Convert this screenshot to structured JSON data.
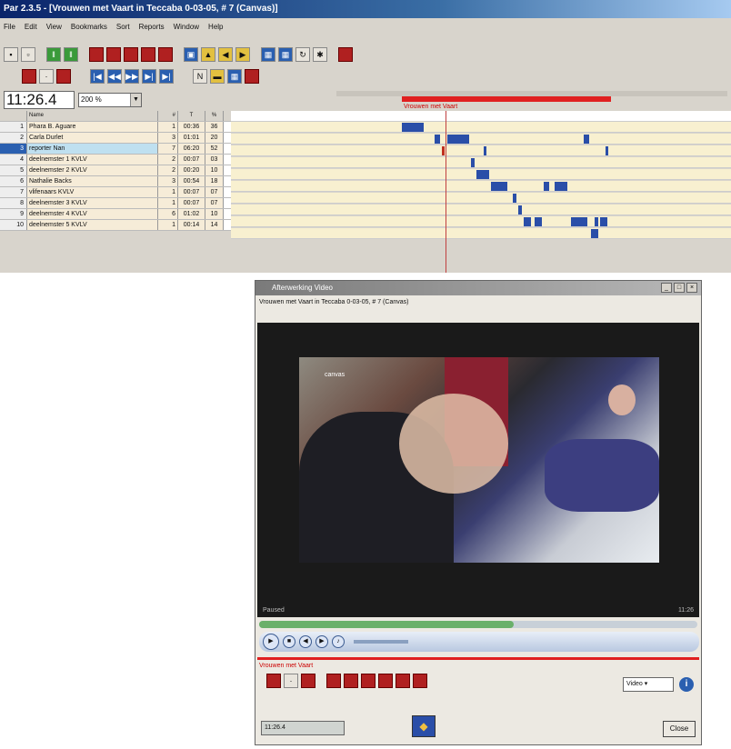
{
  "window": {
    "title": "Par 2.3.5 - [Vrouwen met Vaart in Teccaba 0-03-05, # 7 (Canvas)]"
  },
  "menu": [
    "File",
    "Edit",
    "View",
    "Bookmarks",
    "Sort",
    "Reports",
    "Window",
    "Help"
  ],
  "toolbar": {
    "time": "11:26.4",
    "zoom": "200 %"
  },
  "timeline": {
    "selection_label": "Vrouwen met Vaart"
  },
  "table": {
    "headers": [
      "",
      "Name",
      "#",
      "T",
      "%"
    ],
    "rows": [
      {
        "num": "1",
        "name": "Phara B. Aguare",
        "count": "1",
        "time": "00:36",
        "pct": "36"
      },
      {
        "num": "2",
        "name": "Carla Durlet",
        "count": "3",
        "time": "01:01",
        "pct": "20"
      },
      {
        "num": "3",
        "name": "reporter Nan",
        "count": "7",
        "time": "06:20",
        "pct": "52",
        "selected": true
      },
      {
        "num": "4",
        "name": "deelnemster 1 KVLV",
        "count": "2",
        "time": "00:07",
        "pct": "03"
      },
      {
        "num": "5",
        "name": "deelnemster 2 KVLV",
        "count": "2",
        "time": "00:20",
        "pct": "10"
      },
      {
        "num": "6",
        "name": "Nathalie Backs",
        "count": "3",
        "time": "00:54",
        "pct": "18"
      },
      {
        "num": "7",
        "name": "vlifenaars KVLV",
        "count": "1",
        "time": "00:07",
        "pct": "07"
      },
      {
        "num": "8",
        "name": "deelnemster 3 KVLV",
        "count": "1",
        "time": "00:07",
        "pct": "07"
      },
      {
        "num": "9",
        "name": "deelnemster 4 KVLV",
        "count": "6",
        "time": "01:02",
        "pct": "10"
      },
      {
        "num": "10",
        "name": "deelnemster 5 KVLV",
        "count": "1",
        "time": "00:14",
        "pct": "14"
      }
    ]
  },
  "video_window": {
    "title": "Afterwerking Video",
    "subtitle": "Vrouwen met Vaart in Teccaba 0-03-05, # 7 (Canvas)",
    "logo": "canvas",
    "status_left": "Paused",
    "status_right": "11:26",
    "seek_fraction": 0.58,
    "section_label": "Vrouwen met Vaart",
    "mode_select": "Video",
    "time_field": "11:26.4",
    "close_label": "Close"
  },
  "colors": {
    "accent_red": "#e02020",
    "segment_blue": "#2a4ea8",
    "lane_bg": "#f8f0d0"
  }
}
